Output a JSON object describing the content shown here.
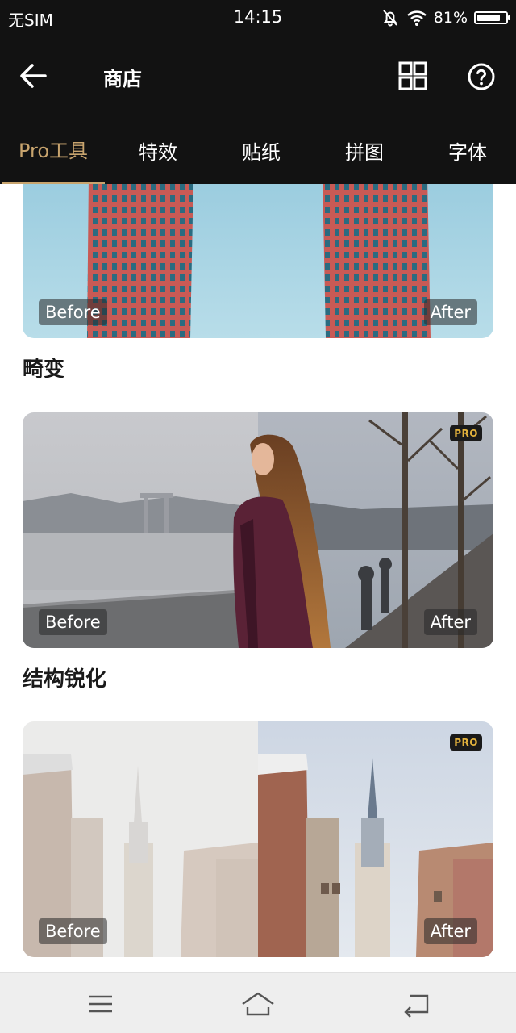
{
  "status_bar": {
    "carrier": "无SIM",
    "time": "14:15",
    "battery": "81%",
    "battery_level": 0.81
  },
  "header": {
    "title": "商店",
    "icons": {
      "back": "arrow-left-icon",
      "grid": "grid-icon",
      "help": "help-icon"
    }
  },
  "tabs": [
    {
      "label": "Pro工具",
      "active": true
    },
    {
      "label": "特效",
      "active": false
    },
    {
      "label": "贴纸",
      "active": false
    },
    {
      "label": "拼图",
      "active": false
    },
    {
      "label": "字体",
      "active": false
    }
  ],
  "accent_color": "#c8a46e",
  "items": [
    {
      "title": "畸变",
      "before": "Before",
      "after": "After",
      "badge": ""
    },
    {
      "title": "结构锐化",
      "before": "Before",
      "after": "After",
      "badge": "PRO"
    },
    {
      "title": "",
      "before": "Before",
      "after": "After",
      "badge": "PRO"
    }
  ],
  "nav_bar": {
    "icons": [
      "menu-icon",
      "home-icon",
      "back-icon"
    ]
  }
}
